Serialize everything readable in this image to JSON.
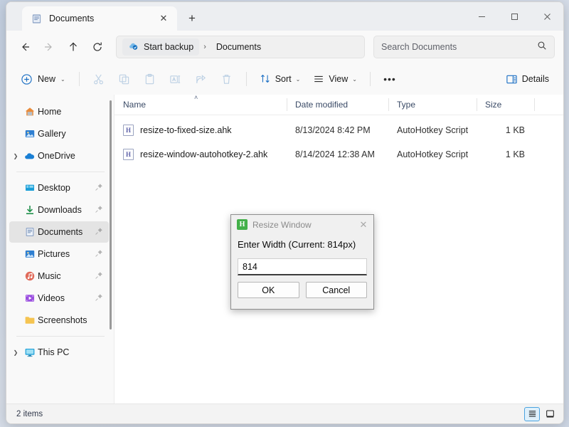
{
  "window": {
    "tab": {
      "label": "Documents",
      "icon": "documents-folder-icon",
      "close_label": "✕",
      "new_tab_label": "+"
    },
    "controls": {
      "minimize": "─",
      "maximize": "☐",
      "close": "✕"
    }
  },
  "nav": {
    "back": "←",
    "forward": "→",
    "up": "↑",
    "refresh": "⟳",
    "breadcrumb": [
      {
        "label": "Start backup",
        "icon": "onedrive-cloud-icon",
        "chip": true
      },
      {
        "label": "Documents",
        "icon": "",
        "chip": false
      }
    ],
    "separator": "›"
  },
  "search": {
    "placeholder": "Search Documents",
    "value": "",
    "icon": "search-icon"
  },
  "toolbar": {
    "new_label": "New",
    "cut_label": "Cut",
    "copy_label": "Copy",
    "paste_label": "Paste",
    "rename_label": "Rename",
    "share_label": "Share",
    "delete_label": "Delete",
    "sort_label": "Sort",
    "view_label": "View",
    "more_label": "•••",
    "details_label": "Details",
    "chevron": "⌄"
  },
  "sidebar": {
    "groups": [
      {
        "items": [
          {
            "label": "Home",
            "icon": "home-icon",
            "twisty": false,
            "pinned": false,
            "selected": false
          },
          {
            "label": "Gallery",
            "icon": "gallery-icon",
            "twisty": false,
            "pinned": false,
            "selected": false
          },
          {
            "label": "OneDrive",
            "icon": "onedrive-icon",
            "twisty": true,
            "pinned": false,
            "selected": false
          }
        ]
      },
      {
        "items": [
          {
            "label": "Desktop",
            "icon": "desktop-icon",
            "twisty": false,
            "pinned": true,
            "selected": false
          },
          {
            "label": "Downloads",
            "icon": "downloads-icon",
            "twisty": false,
            "pinned": true,
            "selected": false
          },
          {
            "label": "Documents",
            "icon": "documents-icon",
            "twisty": false,
            "pinned": true,
            "selected": true
          },
          {
            "label": "Pictures",
            "icon": "pictures-icon",
            "twisty": false,
            "pinned": true,
            "selected": false
          },
          {
            "label": "Music",
            "icon": "music-icon",
            "twisty": false,
            "pinned": true,
            "selected": false
          },
          {
            "label": "Videos",
            "icon": "videos-icon",
            "twisty": false,
            "pinned": true,
            "selected": false
          },
          {
            "label": "Screenshots",
            "icon": "folder-icon",
            "twisty": false,
            "pinned": false,
            "selected": false
          }
        ]
      },
      {
        "items": [
          {
            "label": "This PC",
            "icon": "this-pc-icon",
            "twisty": true,
            "pinned": false,
            "selected": false
          }
        ]
      }
    ]
  },
  "file_list": {
    "columns": [
      {
        "key": "name",
        "label": "Name",
        "sorted": "asc"
      },
      {
        "key": "date",
        "label": "Date modified",
        "sorted": ""
      },
      {
        "key": "type",
        "label": "Type",
        "sorted": ""
      },
      {
        "key": "size",
        "label": "Size",
        "sorted": ""
      }
    ],
    "sort_caret": "˄",
    "rows": [
      {
        "name": "resize-to-fixed-size.ahk",
        "date": "8/13/2024 8:42 PM",
        "type": "AutoHotkey Script",
        "size": "1 KB",
        "icon": "ahk-script-icon",
        "icon_letter": "H"
      },
      {
        "name": "resize-window-autohotkey-2.ahk",
        "date": "8/14/2024 12:38 AM",
        "type": "AutoHotkey Script",
        "size": "1 KB",
        "icon": "ahk-script-icon",
        "icon_letter": "H"
      }
    ]
  },
  "status": {
    "count": "2 items",
    "details_view_label": "Details view",
    "large_icons_label": "Large icons view"
  },
  "dialog": {
    "title": "Resize Window",
    "icon_letter": "H",
    "close": "✕",
    "label": "Enter Width (Current: 814px)",
    "input_value": "814",
    "input_placeholder": "",
    "ok_label": "OK",
    "cancel_label": "Cancel"
  },
  "colors": {
    "accent": "#0078d4",
    "ahk_green": "#43b049",
    "selection": "#e4e4e4",
    "toggle_active_border": "#4aa3df"
  }
}
